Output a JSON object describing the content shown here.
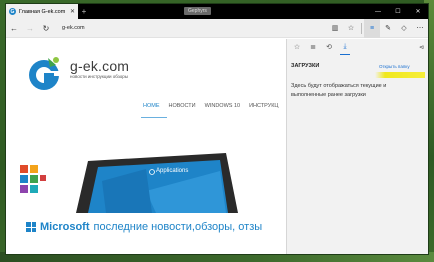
{
  "tab": {
    "title": "Главная G-ek.com",
    "favicon_letter": "G"
  },
  "window_label": "Gephyrs",
  "nav": {
    "address": "g-ek.com"
  },
  "site": {
    "logo_text": "g-ek.com",
    "logo_subtitle": "новости инструкции обзоры",
    "menu": [
      "HOME",
      "НОВОСТИ",
      "WINDOWS 10",
      "ИНСТРУКЦ"
    ],
    "hero_caption": "Applications",
    "headline_brand": "Microsoft",
    "headline_rest": "последние новости,обзоры, отзы"
  },
  "hub": {
    "heading": "ЗАГРУЗКИ",
    "open_folder": "Открыть папку",
    "empty_text": "Здесь будут отображаться текущие и выполненные ранее загрузки"
  },
  "colors": {
    "accent": "#1e84c8",
    "highlight": "#f0e81e"
  }
}
